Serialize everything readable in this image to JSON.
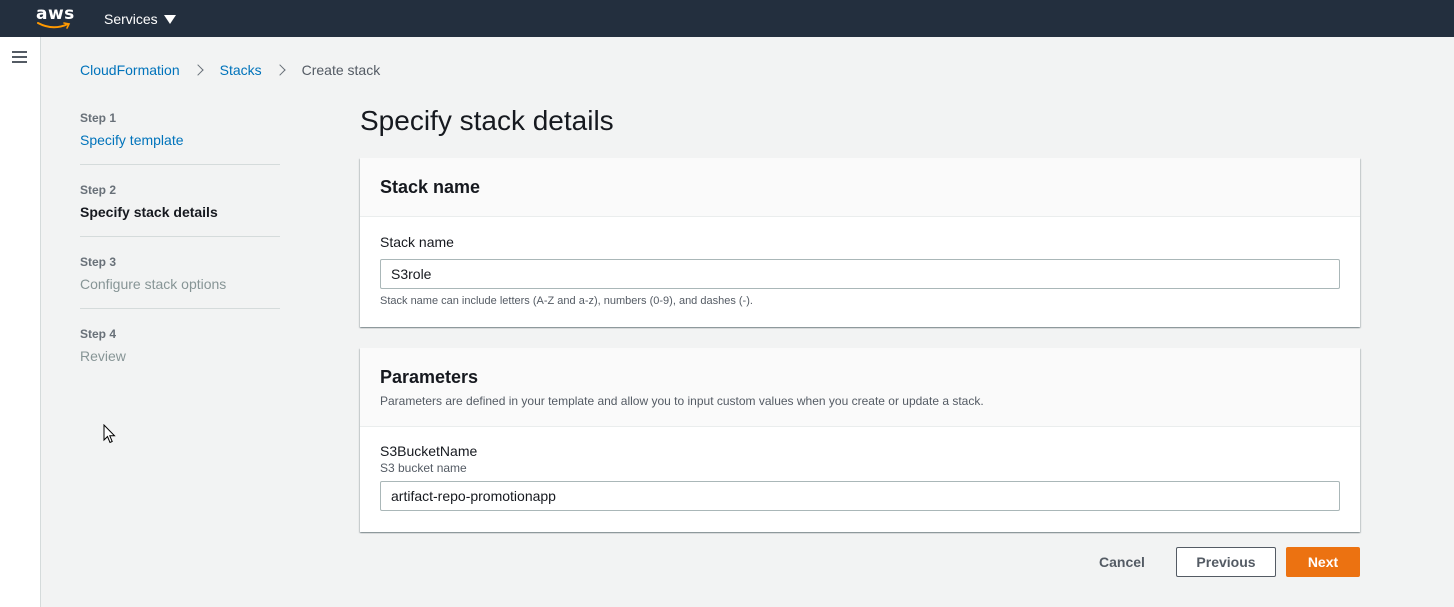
{
  "topnav": {
    "logo_text": "aws",
    "services_label": "Services"
  },
  "breadcrumb": {
    "items": [
      "CloudFormation",
      "Stacks"
    ],
    "current": "Create stack"
  },
  "steps": [
    {
      "num": "Step 1",
      "title": "Specify template",
      "state": "link"
    },
    {
      "num": "Step 2",
      "title": "Specify stack details",
      "state": "active"
    },
    {
      "num": "Step 3",
      "title": "Configure stack options",
      "state": "disabled"
    },
    {
      "num": "Step 4",
      "title": "Review",
      "state": "disabled"
    }
  ],
  "page_title": "Specify stack details",
  "stack_name_panel": {
    "header": "Stack name",
    "field_label": "Stack name",
    "field_value": "S3role",
    "hint": "Stack name can include letters (A-Z and a-z), numbers (0-9), and dashes (-)."
  },
  "parameters_panel": {
    "header": "Parameters",
    "description": "Parameters are defined in your template and allow you to input custom values when you create or update a stack.",
    "param_label": "S3BucketName",
    "param_description": "S3 bucket name",
    "param_value": "artifact-repo-promotionapp"
  },
  "actions": {
    "cancel": "Cancel",
    "previous": "Previous",
    "next": "Next"
  },
  "colors": {
    "nav_bg": "#232f3e",
    "link": "#0073bb",
    "primary": "#ec7211",
    "page_bg": "#f2f3f3"
  }
}
